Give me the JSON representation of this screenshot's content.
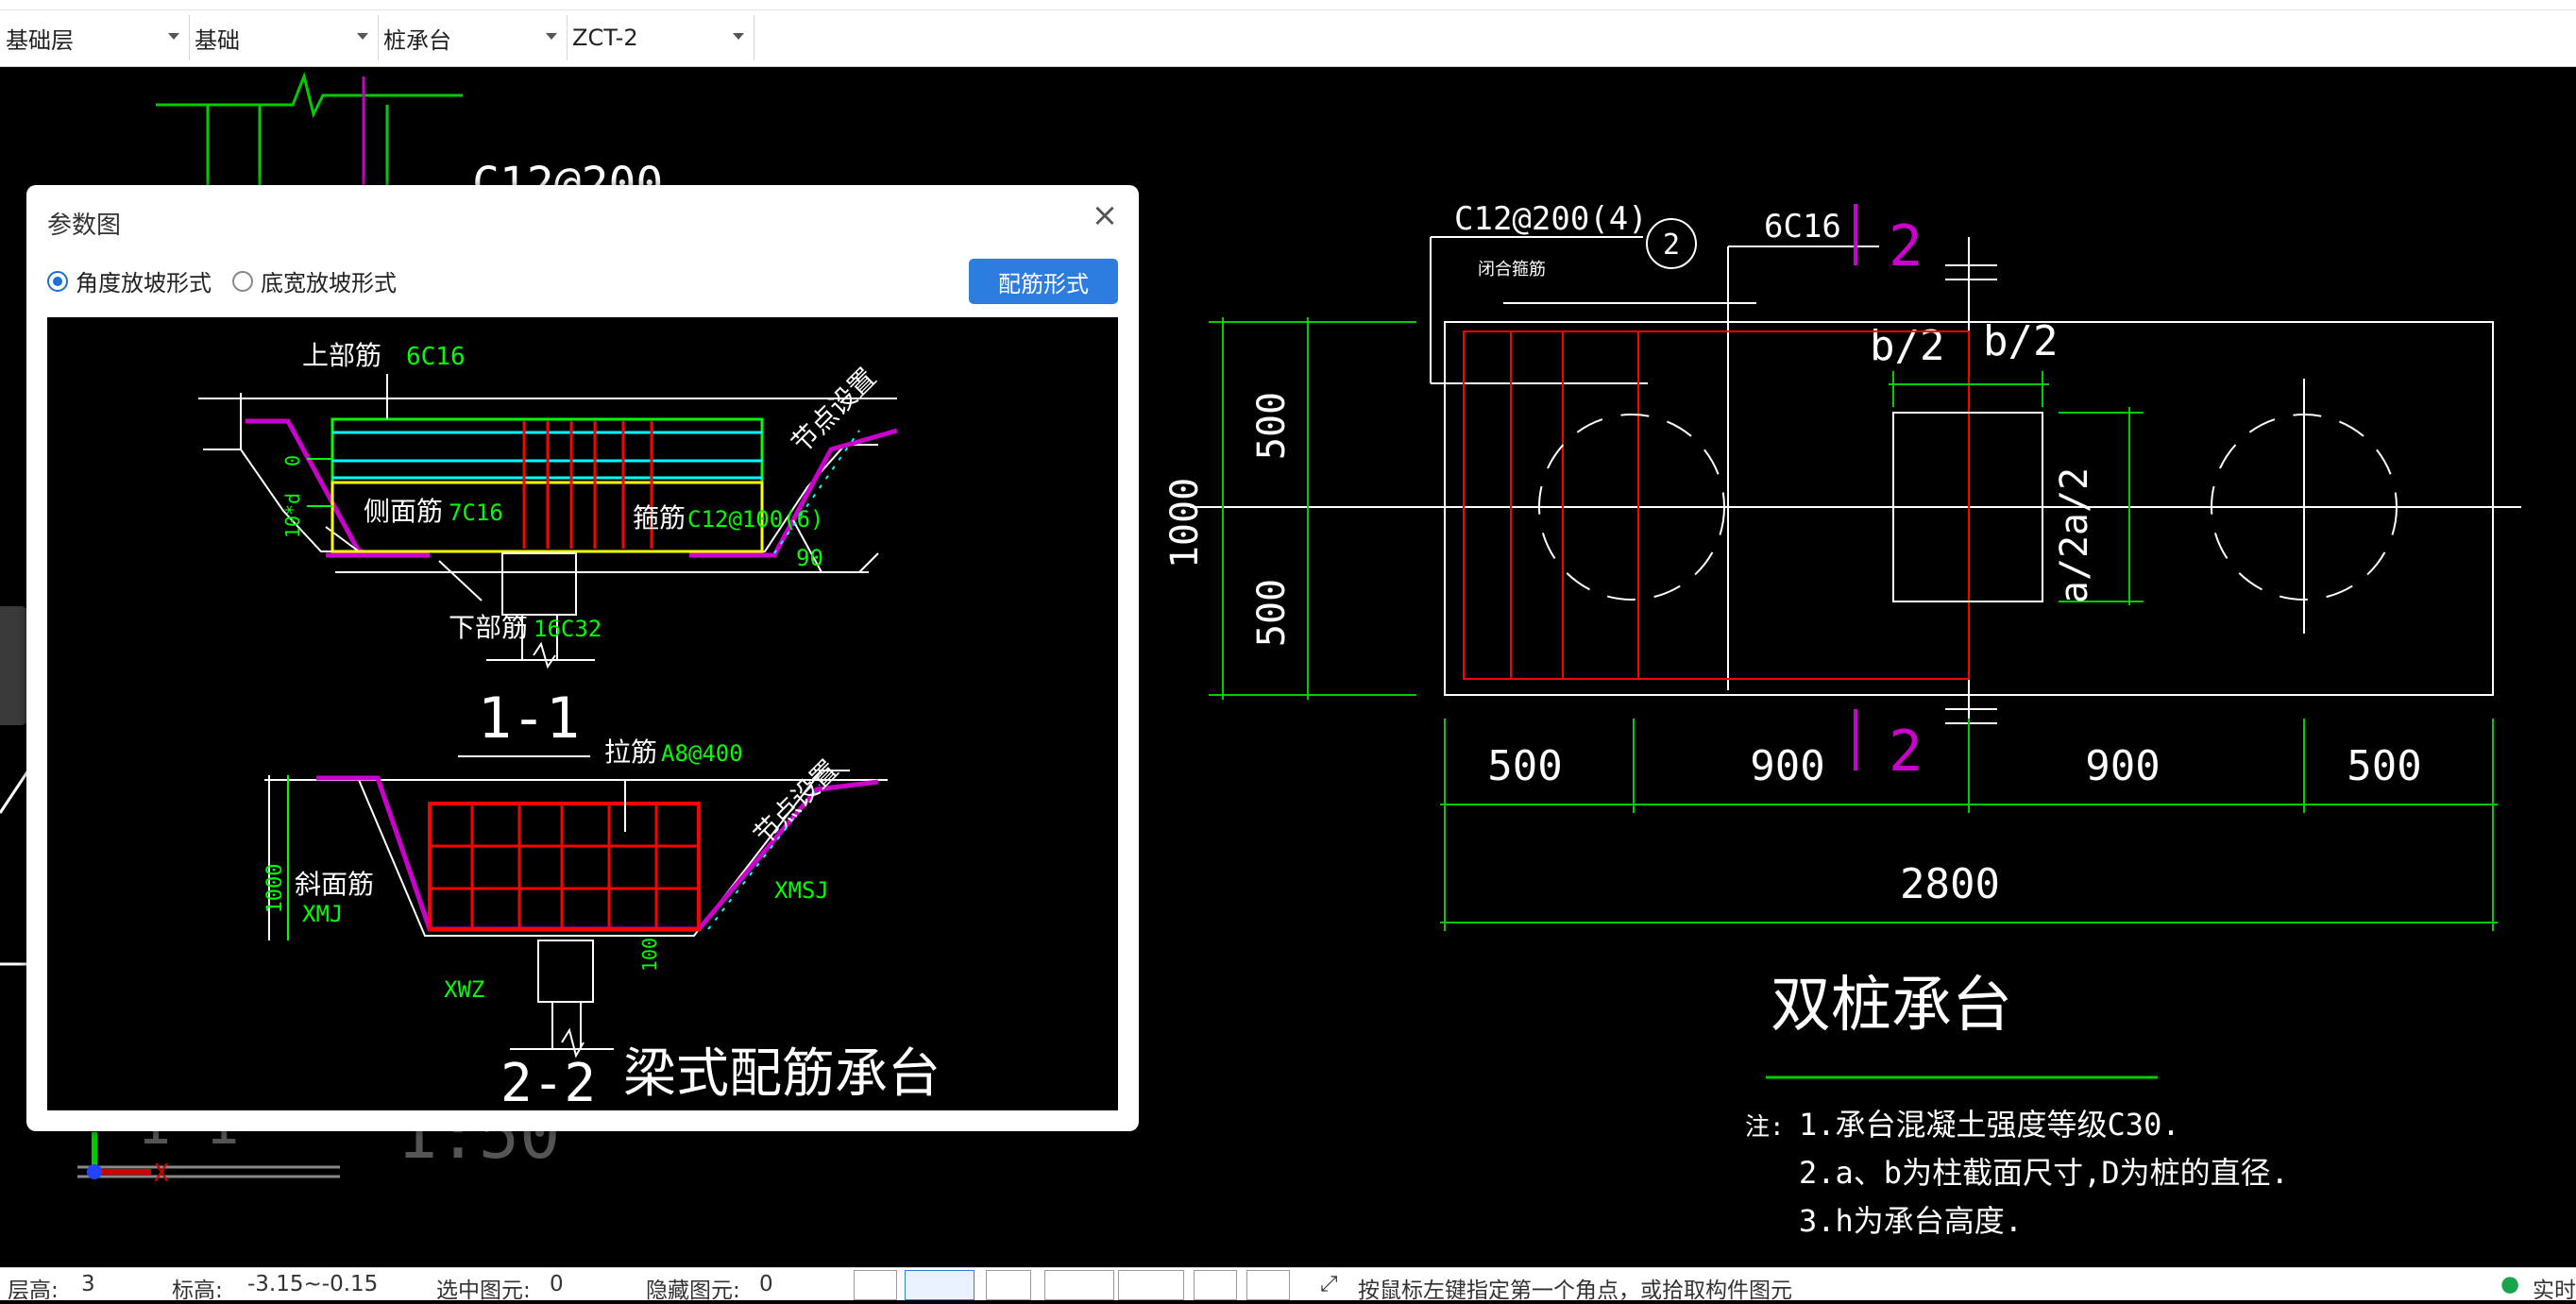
{
  "toolbar": {
    "floor": "基础层",
    "category": "基础",
    "type": "桩承台",
    "component": "ZCT-2"
  },
  "dialog": {
    "title": "参数图",
    "radio_angle": "角度放坡形式",
    "radio_bottom": "底宽放坡形式",
    "rebar_button": "配筋形式"
  },
  "param_drawing": {
    "upper_label": "上部筋",
    "upper_value": "6C16",
    "node_label": "节点设置",
    "side_label": "侧面筋",
    "side_value": "7C16",
    "stirrup_label": "箍筋",
    "stirrup_value": "C12@100(6)",
    "bottom_label": "下部筋",
    "bottom_value": "16C32",
    "angle": "90",
    "dim_zero": "0",
    "dim_10d": "10*d",
    "sec1": "1-1",
    "tie_label": "拉筋",
    "tie_value": "A8@400",
    "slope_label": "斜面筋",
    "xmj": "XMJ",
    "xmsj": "XMSJ",
    "xwz": "XWZ",
    "dim_1000": "1000",
    "dim_100": "100",
    "sec2": "2-2",
    "caption": "梁式配筋承台"
  },
  "bg_drawing": {
    "bg_text_top": "C12@200",
    "bg_big1": "1",
    "bg_1_1": "1 1",
    "bg_scale": "1:50"
  },
  "main_drawing": {
    "c12": "C12@200(4)",
    "circ2": "2",
    "tiny_note": "闭合箍筋",
    "c6": "6C16",
    "sec2": "2",
    "b2a": "b/2",
    "b2b": "b/2",
    "a2a": "a/2",
    "a2b": "a/2",
    "v500a": "500",
    "v500b": "500",
    "v1000": "1000",
    "d500a": "500",
    "d900a": "900",
    "d900b": "900",
    "d500b": "500",
    "d2800": "2800",
    "title": "双桩承台",
    "note_label": "注:",
    "note1": "1.承台混凝土强度等级C30.",
    "note2": "2.a、b为柱截面尺寸,D为桩的直径.",
    "note3": "3.h为承台高度."
  },
  "status": {
    "floor_height_label": "层高:",
    "floor_height": "3",
    "elev_label": "标高:",
    "elev": "-3.15~-0.15",
    "selected_label": "选中图元:",
    "selected": "0",
    "hidden_label": "隐藏图元:",
    "hidden": "0",
    "hint": "按鼠标左键指定第一个角点，或拾取构件图元",
    "right": "实时"
  },
  "colors": {
    "green": "#00cc00",
    "white": "#ffffff",
    "red": "#ff0000",
    "magenta": "#cc00cc",
    "cyan": "#00ffff",
    "yellow": "#ffff00",
    "blue_btn": "#2d7de0"
  }
}
